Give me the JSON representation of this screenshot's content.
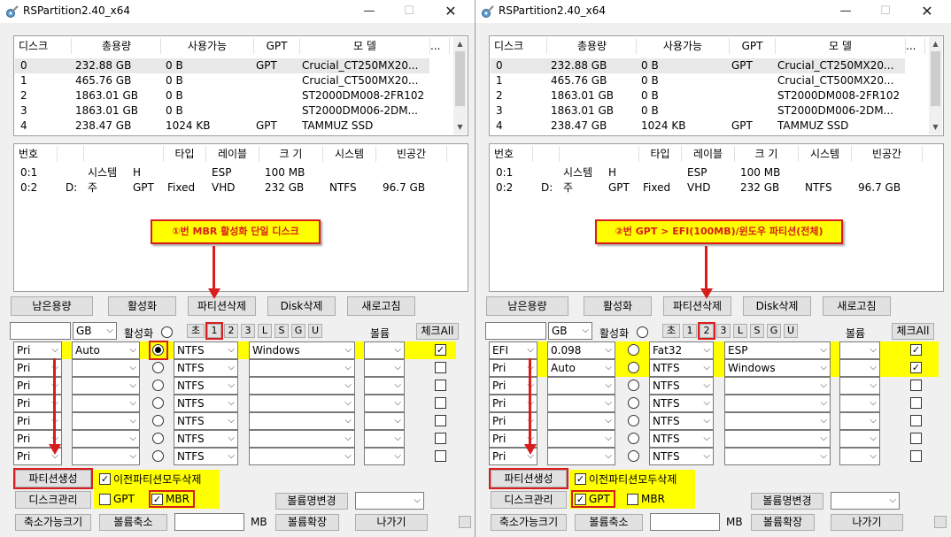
{
  "windows": [
    {
      "title": "RSPartition2.40_x64",
      "disk_list": {
        "headers": [
          "디스크",
          "총용량",
          "사용가능",
          "GPT",
          "모      델",
          "..."
        ],
        "rows": [
          [
            "0",
            "232.88 GB",
            "0 B",
            "GPT",
            "Crucial_CT250MX20..."
          ],
          [
            "1",
            "465.76 GB",
            "0 B",
            "",
            "Crucial_CT500MX20..."
          ],
          [
            "2",
            "1863.01 GB",
            "0 B",
            "",
            "ST2000DM008-2FR102"
          ],
          [
            "3",
            "1863.01 GB",
            "0 B",
            "",
            "ST2000DM006-2DM..."
          ],
          [
            "4",
            "238.47 GB",
            "1024 KB",
            "GPT",
            "TAMMUZ SSD"
          ]
        ]
      },
      "part_list": {
        "headers": [
          "번호",
          "",
          "",
          "타입",
          "레이블",
          "크 기",
          "시스템",
          "빈공간"
        ],
        "rows": [
          [
            "0:1",
            "",
            "시스템",
            "H",
            "",
            "ESP",
            "100 MB",
            "",
            ""
          ],
          [
            "0:2",
            "D:",
            "주",
            "GPT",
            "Fixed",
            "VHD",
            "232 GB",
            "NTFS",
            "96.7 GB"
          ]
        ]
      },
      "callout": "①번 MBR 활성화 단일 디스크",
      "buttons": {
        "remaining": "남은용량",
        "activate": "활성화",
        "delete_part": "파티션삭제",
        "delete_disk": "Disk삭제",
        "refresh": "새로고침"
      },
      "size_unit": "GB",
      "active_label": "활성화",
      "init_label": "초",
      "num_buttons": [
        "1",
        "2",
        "3",
        "L",
        "S",
        "G",
        "U"
      ],
      "volume_label": "볼륨",
      "check_all": "체크All",
      "rows": [
        {
          "type": "Pri",
          "size": "Auto",
          "active": true,
          "fs": "NTFS",
          "label": "Windows",
          "checked": true
        },
        {
          "type": "Pri",
          "size": "",
          "active": false,
          "fs": "NTFS",
          "label": "",
          "checked": false
        },
        {
          "type": "Pri",
          "size": "",
          "active": false,
          "fs": "NTFS",
          "label": "",
          "checked": false
        },
        {
          "type": "Pri",
          "size": "",
          "active": false,
          "fs": "NTFS",
          "label": "",
          "checked": false
        },
        {
          "type": "Pri",
          "size": "",
          "active": false,
          "fs": "NTFS",
          "label": "",
          "checked": false
        },
        {
          "type": "Pri",
          "size": "",
          "active": false,
          "fs": "NTFS",
          "label": "",
          "checked": false
        },
        {
          "type": "Pri",
          "size": "",
          "active": false,
          "fs": "NTFS",
          "label": "",
          "checked": false
        }
      ],
      "bottom": {
        "create": "파티션생성",
        "delete_prev": "이전파티션모두삭제",
        "disk_mgmt": "디스크관리",
        "gpt": "GPT",
        "mbr": "MBR",
        "rename": "볼륨명변경",
        "shrink_size": "축소가능크기",
        "shrink": "볼륨축소",
        "mb": "MB",
        "extend": "볼륨확장",
        "exit": "나가기"
      },
      "gpt_checked": false,
      "mbr_checked": true,
      "highlight_num": "1"
    },
    {
      "title": "RSPartition2.40_x64",
      "disk_list": {
        "headers": [
          "디스크",
          "총용량",
          "사용가능",
          "GPT",
          "모      델",
          "..."
        ],
        "rows": [
          [
            "0",
            "232.88 GB",
            "0 B",
            "GPT",
            "Crucial_CT250MX20..."
          ],
          [
            "1",
            "465.76 GB",
            "0 B",
            "",
            "Crucial_CT500MX20..."
          ],
          [
            "2",
            "1863.01 GB",
            "0 B",
            "",
            "ST2000DM008-2FR102"
          ],
          [
            "3",
            "1863.01 GB",
            "0 B",
            "",
            "ST2000DM006-2DM..."
          ],
          [
            "4",
            "238.47 GB",
            "1024 KB",
            "GPT",
            "TAMMUZ SSD"
          ]
        ]
      },
      "part_list": {
        "headers": [
          "번호",
          "",
          "",
          "타입",
          "레이블",
          "크 기",
          "시스템",
          "빈공간"
        ],
        "rows": [
          [
            "0:1",
            "",
            "시스템",
            "H",
            "",
            "ESP",
            "100 MB",
            "",
            ""
          ],
          [
            "0:2",
            "D:",
            "주",
            "GPT",
            "Fixed",
            "VHD",
            "232 GB",
            "NTFS",
            "96.7 GB"
          ]
        ]
      },
      "callout": "②번 GPT > EFI(100MB)/윈도우 파티션(전체)",
      "buttons": {
        "remaining": "남은용량",
        "activate": "활성화",
        "delete_part": "파티션삭제",
        "delete_disk": "Disk삭제",
        "refresh": "새로고침"
      },
      "size_unit": "GB",
      "active_label": "활성화",
      "init_label": "초",
      "num_buttons": [
        "1",
        "2",
        "3",
        "L",
        "S",
        "G",
        "U"
      ],
      "volume_label": "볼륨",
      "check_all": "체크All",
      "rows": [
        {
          "type": "EFI",
          "size": "0.098",
          "active": false,
          "fs": "Fat32",
          "label": "ESP",
          "checked": true
        },
        {
          "type": "Pri",
          "size": "Auto",
          "active": false,
          "fs": "NTFS",
          "label": "Windows",
          "checked": true
        },
        {
          "type": "Pri",
          "size": "",
          "active": false,
          "fs": "NTFS",
          "label": "",
          "checked": false
        },
        {
          "type": "Pri",
          "size": "",
          "active": false,
          "fs": "NTFS",
          "label": "",
          "checked": false
        },
        {
          "type": "Pri",
          "size": "",
          "active": false,
          "fs": "NTFS",
          "label": "",
          "checked": false
        },
        {
          "type": "Pri",
          "size": "",
          "active": false,
          "fs": "NTFS",
          "label": "",
          "checked": false
        },
        {
          "type": "Pri",
          "size": "",
          "active": false,
          "fs": "NTFS",
          "label": "",
          "checked": false
        }
      ],
      "bottom": {
        "create": "파티션생성",
        "delete_prev": "이전파티션모두삭제",
        "disk_mgmt": "디스크관리",
        "gpt": "GPT",
        "mbr": "MBR",
        "rename": "볼륨명변경",
        "shrink_size": "축소가능크기",
        "shrink": "볼륨축소",
        "mb": "MB",
        "extend": "볼륨확장",
        "exit": "나가기"
      },
      "gpt_checked": true,
      "mbr_checked": false,
      "highlight_num": "2"
    }
  ]
}
